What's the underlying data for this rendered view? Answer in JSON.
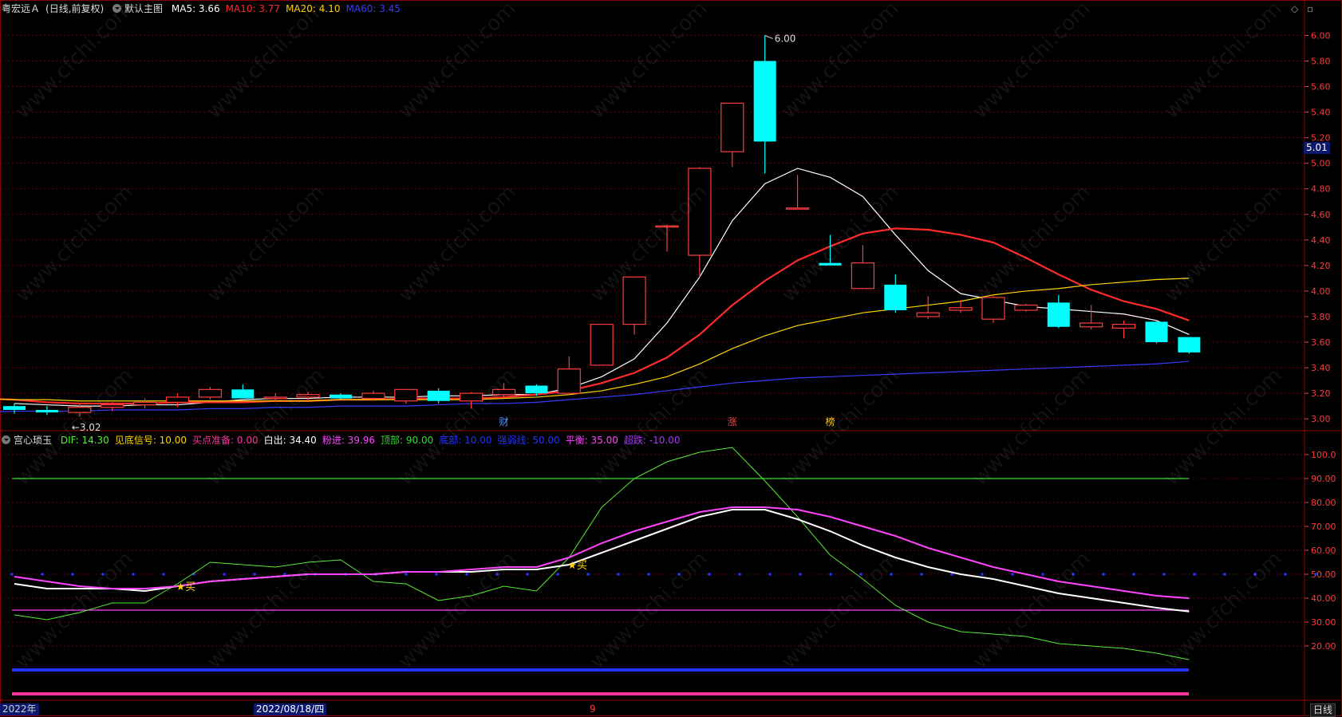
{
  "header": {
    "stock_name": "粤宏远Ａ",
    "period": "(日线,前复权)",
    "main_chart": "默认主图",
    "ma": [
      {
        "label": "MA5:",
        "value": "3.66",
        "color": "#ffffff"
      },
      {
        "label": "MA10:",
        "value": "3.77",
        "color": "#ff2a2a"
      },
      {
        "label": "MA20:",
        "value": "4.10",
        "color": "#ffd400"
      },
      {
        "label": "MA60:",
        "value": "3.45",
        "color": "#3a3aff"
      }
    ]
  },
  "indicator_header": {
    "name": "宫心琐玉",
    "items": [
      {
        "label": "DIF:",
        "value": "14.30",
        "color": "#55ee33"
      },
      {
        "label": "见底信号:",
        "value": "10.00",
        "color": "#ffd400"
      },
      {
        "label": "买点准备:",
        "value": "0.00",
        "color": "#ff3399"
      },
      {
        "label": "白出:",
        "value": "34.40",
        "color": "#ffffff"
      },
      {
        "label": "粉进:",
        "value": "39.96",
        "color": "#ff44ff"
      },
      {
        "label": "顶部:",
        "value": "90.00",
        "color": "#33dd33"
      },
      {
        "label": "底部:",
        "value": "10.00",
        "color": "#2233ff"
      },
      {
        "label": "强弱线:",
        "value": "50.00",
        "color": "#2233ff"
      },
      {
        "label": "平衡:",
        "value": "35.00",
        "color": "#ff44ff"
      },
      {
        "label": "超跌:",
        "value": "-10.00",
        "color": "#aa33ff"
      }
    ]
  },
  "price_axis": {
    "ticks": [
      "6.00",
      "5.80",
      "5.60",
      "5.40",
      "5.20",
      "5.00",
      "4.80",
      "4.60",
      "4.40",
      "4.20",
      "4.00",
      "3.80",
      "3.60",
      "3.40",
      "3.20",
      "3.00"
    ],
    "current_price": "5.01"
  },
  "indicator_axis": {
    "ticks": [
      "100.0",
      "90.00",
      "80.00",
      "70.00",
      "60.00",
      "50.00",
      "40.00",
      "30.00",
      "20.00"
    ]
  },
  "annotations": {
    "high_label": "6.00",
    "low_label": "3.02",
    "event_markers": [
      {
        "text": "财",
        "color": "#5599ff"
      },
      {
        "text": "涨",
        "color": "#ff4444"
      },
      {
        "text": "榜",
        "color": "#ffcc00"
      }
    ],
    "buy_label": "买"
  },
  "bottom_bar": {
    "year": "2022年",
    "date": "2022/08/18/四",
    "month": "9",
    "period_button": "日线"
  },
  "colors": {
    "up": "#ff3b3b",
    "down": "#00ffff",
    "grid": "#6a0000",
    "axis_text": "#ff3b3b"
  },
  "chart_data": [
    {
      "type": "candlestick",
      "title": "粤宏远Ａ (日线,前复权)",
      "ylim": [
        2.92,
        6.14
      ],
      "candles": [
        {
          "o": 3.1,
          "h": 3.12,
          "l": 3.04,
          "c": 3.07
        },
        {
          "o": 3.07,
          "h": 3.1,
          "l": 3.03,
          "c": 3.05
        },
        {
          "o": 3.05,
          "h": 3.12,
          "l": 3.02,
          "c": 3.09
        },
        {
          "o": 3.09,
          "h": 3.13,
          "l": 3.06,
          "c": 3.11
        },
        {
          "o": 3.11,
          "h": 3.16,
          "l": 3.08,
          "c": 3.13
        },
        {
          "o": 3.13,
          "h": 3.2,
          "l": 3.09,
          "c": 3.17
        },
        {
          "o": 3.17,
          "h": 3.25,
          "l": 3.15,
          "c": 3.23
        },
        {
          "o": 3.23,
          "h": 3.27,
          "l": 3.18,
          "c": 3.16
        },
        {
          "o": 3.16,
          "h": 3.2,
          "l": 3.13,
          "c": 3.17
        },
        {
          "o": 3.17,
          "h": 3.21,
          "l": 3.14,
          "c": 3.19
        },
        {
          "o": 3.19,
          "h": 3.2,
          "l": 3.15,
          "c": 3.16
        },
        {
          "o": 3.16,
          "h": 3.22,
          "l": 3.14,
          "c": 3.2
        },
        {
          "o": 3.14,
          "h": 3.22,
          "l": 3.12,
          "c": 3.23
        },
        {
          "o": 3.22,
          "h": 3.24,
          "l": 3.12,
          "c": 3.14
        },
        {
          "o": 3.14,
          "h": 3.21,
          "l": 3.08,
          "c": 3.2
        },
        {
          "o": 3.19,
          "h": 3.28,
          "l": 3.17,
          "c": 3.23
        },
        {
          "o": 3.26,
          "h": 3.27,
          "l": 3.18,
          "c": 3.2
        },
        {
          "o": 3.2,
          "h": 3.49,
          "l": 3.19,
          "c": 3.39
        },
        {
          "o": 3.42,
          "h": 3.74,
          "l": 3.42,
          "c": 3.74
        },
        {
          "o": 3.74,
          "h": 4.11,
          "l": 3.66,
          "c": 4.11
        },
        {
          "o": 4.51,
          "h": 4.52,
          "l": 4.31,
          "c": 4.51
        },
        {
          "o": 4.28,
          "h": 4.97,
          "l": 4.11,
          "c": 4.96
        },
        {
          "o": 5.09,
          "h": 5.47,
          "l": 4.97,
          "c": 5.47
        },
        {
          "o": 5.8,
          "h": 6.0,
          "l": 4.92,
          "c": 5.17
        },
        {
          "o": 4.65,
          "h": 4.91,
          "l": 4.65,
          "c": 4.65
        },
        {
          "o": 4.22,
          "h": 4.44,
          "l": 4.2,
          "c": 4.2
        },
        {
          "o": 4.02,
          "h": 4.36,
          "l": 4.02,
          "c": 4.22
        },
        {
          "o": 4.05,
          "h": 4.13,
          "l": 3.83,
          "c": 3.85
        },
        {
          "o": 3.8,
          "h": 3.96,
          "l": 3.78,
          "c": 3.83
        },
        {
          "o": 3.85,
          "h": 3.93,
          "l": 3.83,
          "c": 3.87
        },
        {
          "o": 3.78,
          "h": 3.96,
          "l": 3.75,
          "c": 3.95
        },
        {
          "o": 3.85,
          "h": 3.9,
          "l": 3.84,
          "c": 3.89
        },
        {
          "o": 3.91,
          "h": 3.97,
          "l": 3.71,
          "c": 3.72
        },
        {
          "o": 3.72,
          "h": 3.89,
          "l": 3.7,
          "c": 3.75
        },
        {
          "o": 3.71,
          "h": 3.77,
          "l": 3.63,
          "c": 3.74
        },
        {
          "o": 3.76,
          "h": 3.77,
          "l": 3.59,
          "c": 3.6
        },
        {
          "o": 3.64,
          "h": 3.64,
          "l": 3.51,
          "c": 3.52
        }
      ],
      "series": [
        {
          "name": "MA5",
          "color": "#ffffff",
          "values": [
            3.12,
            3.11,
            3.1,
            3.1,
            3.11,
            3.11,
            3.13,
            3.15,
            3.16,
            3.16,
            3.17,
            3.17,
            3.17,
            3.18,
            3.18,
            3.19,
            3.19,
            3.24,
            3.33,
            3.47,
            3.75,
            4.11,
            4.55,
            4.84,
            4.96,
            4.89,
            4.74,
            4.44,
            4.16,
            3.98,
            3.93,
            3.88,
            3.86,
            3.84,
            3.82,
            3.77,
            3.66
          ]
        },
        {
          "name": "MA10",
          "color": "#ff2a2a",
          "values": [
            3.16,
            3.15,
            3.13,
            3.12,
            3.12,
            3.12,
            3.13,
            3.13,
            3.13,
            3.14,
            3.14,
            3.15,
            3.15,
            3.16,
            3.16,
            3.16,
            3.17,
            3.19,
            3.22,
            3.28,
            3.36,
            3.48,
            3.66,
            3.89,
            4.08,
            4.24,
            4.35,
            4.45,
            4.49,
            4.48,
            4.44,
            4.38,
            4.26,
            4.13,
            4.01,
            3.92,
            3.86,
            3.77
          ]
        },
        {
          "name": "MA20",
          "color": "#ffd400",
          "values": [
            3.16,
            3.15,
            3.15,
            3.14,
            3.14,
            3.14,
            3.14,
            3.14,
            3.14,
            3.14,
            3.14,
            3.15,
            3.15,
            3.15,
            3.15,
            3.15,
            3.16,
            3.17,
            3.19,
            3.22,
            3.27,
            3.33,
            3.43,
            3.55,
            3.65,
            3.73,
            3.78,
            3.83,
            3.86,
            3.89,
            3.92,
            3.97,
            4.0,
            4.02,
            4.05,
            4.07,
            4.09,
            4.1
          ]
        },
        {
          "name": "MA60",
          "color": "#3a3aff",
          "values": [
            3.05,
            3.06,
            3.06,
            3.06,
            3.07,
            3.07,
            3.07,
            3.08,
            3.08,
            3.09,
            3.09,
            3.1,
            3.1,
            3.1,
            3.11,
            3.12,
            3.12,
            3.13,
            3.15,
            3.17,
            3.19,
            3.22,
            3.25,
            3.28,
            3.3,
            3.32,
            3.33,
            3.34,
            3.35,
            3.36,
            3.37,
            3.38,
            3.39,
            3.4,
            3.41,
            3.42,
            3.43,
            3.45
          ]
        }
      ]
    },
    {
      "type": "line",
      "title": "宫心琐玉",
      "ylim": [
        -2,
        106
      ],
      "series": [
        {
          "name": "DIF",
          "color": "#55ee33",
          "values": [
            33,
            31,
            34,
            38,
            38,
            46,
            55,
            54,
            53,
            55,
            56,
            47,
            46,
            39,
            41,
            45,
            43,
            57,
            78,
            90,
            97,
            101,
            103,
            89,
            74,
            58,
            48,
            37,
            30,
            26,
            25,
            24,
            21,
            20,
            19,
            17,
            14.3
          ]
        },
        {
          "name": "白出",
          "color": "#ffffff",
          "values": [
            46,
            44,
            44,
            44,
            43,
            45,
            47,
            48,
            49,
            50,
            50,
            50,
            51,
            51,
            51,
            52,
            52,
            54,
            59,
            64,
            69,
            74,
            77,
            77,
            73,
            68,
            62,
            57,
            53,
            50,
            48,
            45,
            42,
            40,
            38,
            36,
            34.4
          ]
        },
        {
          "name": "粉进",
          "color": "#ff44ff",
          "values": [
            49,
            47,
            45,
            44,
            44,
            45,
            47,
            48,
            49,
            50,
            50,
            50,
            51,
            51,
            52,
            53,
            53,
            57,
            63,
            68,
            72,
            76,
            78,
            78,
            77,
            74,
            70,
            66,
            61,
            57,
            53,
            50,
            47,
            45,
            43,
            41,
            39.96
          ]
        },
        {
          "name": "顶部",
          "color": "#33dd33",
          "values": [
            90
          ]
        },
        {
          "name": "底部",
          "color": "#2233ff",
          "values": [
            10
          ]
        },
        {
          "name": "强弱线",
          "color": "#2233ff",
          "values": [
            50
          ]
        },
        {
          "name": "平衡",
          "color": "#ff44ff",
          "values": [
            35
          ]
        },
        {
          "name": "买点准备",
          "color": "#ff3399",
          "values": [
            0
          ]
        },
        {
          "name": "超跌",
          "color": "#aa33ff",
          "values": [
            -10
          ]
        }
      ],
      "buy_signals": [
        5,
        17
      ]
    }
  ]
}
